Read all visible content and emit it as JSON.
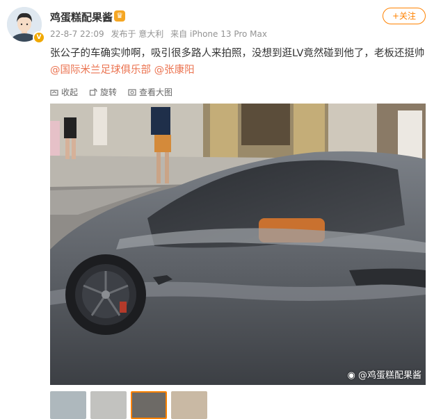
{
  "author": {
    "name": "鸡蛋糕配果酱",
    "level_icon": "vip-crown-icon",
    "verified_badge": "V"
  },
  "meta": {
    "date": "22-8-7 22:09",
    "location": "发布于 意大利",
    "device": "来自 iPhone 13 Pro Max"
  },
  "follow_button": {
    "label": "+关注"
  },
  "post": {
    "text": "张公子的车确实帅啊，吸引很多路人来拍照，没想到逛LV竟然碰到他了，老板还挺帅",
    "mention_1": "@国际米兰足球俱乐部",
    "mention_2": "@张康阳"
  },
  "toolbar": {
    "collapse": "收起",
    "rotate": "旋转",
    "view_large": "查看大图"
  },
  "photo": {
    "watermark": "@鸡蛋糕配果酱",
    "watermark_icon": "weibo-icon"
  },
  "thumbnails": {
    "count": 4,
    "selected_index": 2
  },
  "colors": {
    "accent": "#ff8200",
    "mention": "#eb7350",
    "meta": "#939393"
  }
}
